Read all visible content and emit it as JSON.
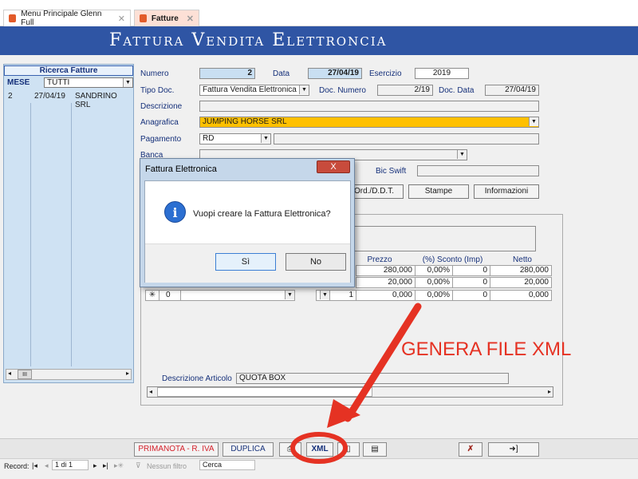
{
  "tabs": [
    {
      "label": "Menu Principale Glenn Full"
    },
    {
      "label": "Fatture"
    }
  ],
  "title": "Fattura Vendita Elettroncia",
  "left_panel": {
    "title": "Ricerca Fatture",
    "mese_label": "MESE",
    "mese_value": "TUTTI",
    "rows": [
      {
        "num": "2",
        "date": "27/04/19",
        "name": "SANDRINO SRL"
      }
    ],
    "scroll_label": "III"
  },
  "form": {
    "numero_label": "Numero",
    "numero_value": "2",
    "data_label": "Data",
    "data_value": "27/04/19",
    "esercizio_label": "Esercizio",
    "esercizio_value": "2019",
    "tipo_doc_label": "Tipo Doc.",
    "tipo_doc_value": "Fattura Vendita Elettronica",
    "doc_numero_label": "Doc. Numero",
    "doc_numero_value": "2/19",
    "doc_data_label": "Doc. Data",
    "doc_data_value": "27/04/19",
    "descrizione_label": "Descrizione",
    "anagrafica_label": "Anagrafica",
    "anagrafica_value": "JUMPING HORSE SRL",
    "pagamento_label": "Pagamento",
    "pagamento_value": "RD",
    "banca_label": "Banca",
    "bic_swift_label": "Bic Swift",
    "btn_ordddt": "Ord./D.D.T.",
    "btn_stampe": "Stampe",
    "btn_informazioni": "Informazioni"
  },
  "grid": {
    "headers": [
      "Prezzo",
      "(%) Sconto (Imp)",
      "Netto"
    ],
    "rows": [
      {
        "prezzo": "280,000",
        "sconto": "0,00%",
        "imp": "0",
        "netto": "280,000"
      },
      {
        "prezzo": "20,000",
        "sconto": "0,00%",
        "imp": "0",
        "netto": "20,000"
      },
      {
        "qty": "1",
        "prezzo": "0,000",
        "sconto": "0,00%",
        "imp": "0",
        "netto": "0,000"
      }
    ],
    "new_row_marker": "✳",
    "new_row_id": "0",
    "descrizione_articolo_label": "Descrizione Articolo",
    "descrizione_articolo_value": "QUOTA BOX"
  },
  "dialog": {
    "title": "Fattura Elettronica",
    "close": "X",
    "message": "Vuopi creare la Fattura Elettronica?",
    "yes": "Sì",
    "no": "No",
    "info_icon": "i"
  },
  "annotation": {
    "text": "GENERA FILE XML"
  },
  "bottom_buttons": {
    "primanota": "PRIMANOTA - R. IVA",
    "duplica": "DUPLICA",
    "xml": "XML"
  },
  "record_nav": {
    "label": "Record:",
    "position": "1 di 1",
    "filter": "Nessun filtro",
    "search": "Cerca"
  },
  "colors": {
    "title_bg": "#2f55a4",
    "accent_red": "#e53223",
    "anagrafica_bg": "#ffc000",
    "panel_blue": "#cfe2f3"
  }
}
